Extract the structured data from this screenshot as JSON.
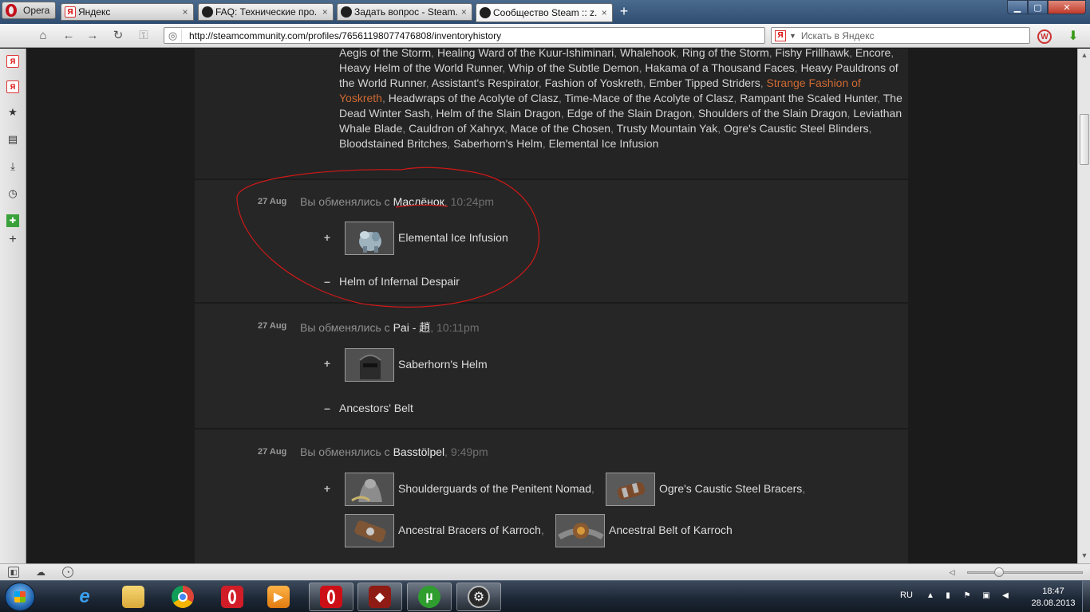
{
  "browser": {
    "menu_label": "Opera",
    "tabs": [
      {
        "label": "Яндекс",
        "favicon": "yandex-icon"
      },
      {
        "label": "FAQ: Технические про...",
        "favicon": "steam-icon"
      },
      {
        "label": "Задать вопрос - Steam...",
        "favicon": "steam-icon"
      },
      {
        "label": "Сообщество Steam :: z...",
        "favicon": "steam-icon",
        "active": true
      }
    ],
    "new_tab_label": "+",
    "url": "http://steamcommunity.com/profiles/76561198077476808/inventoryhistory",
    "search_placeholder": "Искать в Яндекс",
    "search_engine_glyph": "Я"
  },
  "inventory": {
    "received_items": [
      {
        "name": "Aegis of the Storm"
      },
      {
        "name": "Healing Ward of the Kuur-Ishiminari"
      },
      {
        "name": "Whalehook"
      },
      {
        "name": "Ring of the Storm"
      },
      {
        "name": "Fishy Frillhawk"
      },
      {
        "name": "Encore"
      },
      {
        "name": "Heavy Helm of the World Runner"
      },
      {
        "name": "Whip of the Subtle Demon"
      },
      {
        "name": "Hakama of a Thousand Faces"
      },
      {
        "name": "Heavy Pauldrons of the World Runner"
      },
      {
        "name": "Assistant's Respirator"
      },
      {
        "name": "Fashion of Yoskreth"
      },
      {
        "name": "Ember Tipped Striders"
      },
      {
        "name": "Strange Fashion of Yoskreth",
        "strange": true
      },
      {
        "name": "Headwraps of the Acolyte of Clasz"
      },
      {
        "name": "Time-Mace of the Acolyte of Clasz"
      },
      {
        "name": "Rampant the Scaled Hunter"
      },
      {
        "name": "The Dead Winter Sash"
      },
      {
        "name": "Helm of the Slain Dragon"
      },
      {
        "name": "Edge of the Slain Dragon"
      },
      {
        "name": "Shoulders of the Slain Dragon"
      },
      {
        "name": "Leviathan Whale Blade"
      },
      {
        "name": "Cauldron of Xahryx"
      },
      {
        "name": "Mace of the Chosen"
      },
      {
        "name": "Trusty Mountain Yak"
      },
      {
        "name": "Ogre's Caustic Steel Blinders"
      },
      {
        "name": "Bloodstained Britches"
      },
      {
        "name": "Saberhorn's Helm"
      },
      {
        "name": "Elemental Ice Infusion"
      }
    ],
    "trade_prefix": "Вы обменялись с",
    "trades": [
      {
        "date": "27 Aug",
        "partner": "Маслёнок",
        "time": "10:24pm",
        "received": [
          {
            "name": "Elemental Ice Infusion",
            "icon": "elemental-ice-infusion-thumb"
          }
        ],
        "given": [
          {
            "name": "Helm of Infernal Despair"
          }
        ]
      },
      {
        "date": "27 Aug",
        "partner": "Pai - 趙",
        "time": "10:11pm",
        "received": [
          {
            "name": "Saberhorn's Helm",
            "icon": "saberhorns-helm-thumb"
          }
        ],
        "given": [
          {
            "name": "Ancestors' Belt"
          }
        ]
      },
      {
        "date": "27 Aug",
        "partner": "Basstölpel",
        "time": "9:49pm",
        "received": [
          {
            "name": "Shoulderguards of the Penitent Nomad",
            "icon": "shoulderguards-thumb"
          },
          {
            "name": "Ogre's Caustic Steel Bracers",
            "icon": "ogre-bracers-thumb"
          },
          {
            "name": "Ancestral Bracers of Karroch",
            "icon": "ancestral-bracers-thumb"
          },
          {
            "name": "Ancestral Belt of Karroch",
            "icon": "ancestral-belt-thumb"
          }
        ],
        "given": []
      }
    ],
    "plus_sign": "+",
    "minus_sign": "–"
  },
  "colors": {
    "strange": "#cf6a32",
    "panel_bg": "#262626",
    "annotation_red": "#d01818"
  },
  "taskbar": {
    "language": "RU",
    "time": "18:47",
    "date": "28.08.2013",
    "apps": [
      {
        "name": "ie-icon",
        "active": false
      },
      {
        "name": "explorer-icon",
        "active": false
      },
      {
        "name": "chrome-icon",
        "active": false
      },
      {
        "name": "opera-red-icon",
        "active": false
      },
      {
        "name": "media-player-icon",
        "active": false
      },
      {
        "name": "opera-icon",
        "active": true
      },
      {
        "name": "dota2-icon",
        "active": true
      },
      {
        "name": "utorrent-icon",
        "active": true
      },
      {
        "name": "steam-icon",
        "active": true
      }
    ]
  }
}
